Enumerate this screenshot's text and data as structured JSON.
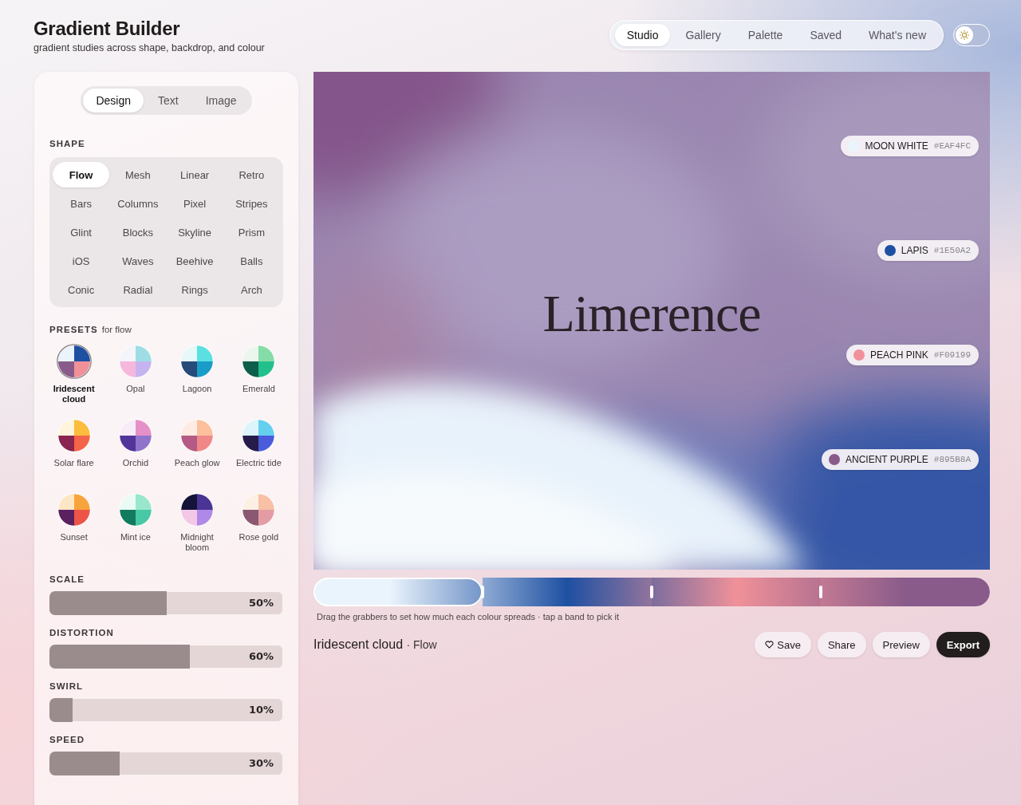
{
  "header": {
    "title": "Gradient Builder",
    "subtitle": "gradient studies across shape, backdrop, and colour"
  },
  "nav": [
    {
      "label": "Studio",
      "selected": true
    },
    {
      "label": "Gallery",
      "selected": false
    },
    {
      "label": "Palette",
      "selected": false
    },
    {
      "label": "Saved",
      "selected": false
    },
    {
      "label": "What's new",
      "selected": false
    }
  ],
  "theme_toggle": {
    "dark": false
  },
  "panel": {
    "tabs": [
      {
        "label": "Design",
        "selected": true
      },
      {
        "label": "Text",
        "selected": false
      },
      {
        "label": "Image",
        "selected": false
      }
    ],
    "shape_label": "SHAPE",
    "shapes": [
      {
        "label": "Flow",
        "selected": true
      },
      {
        "label": "Mesh",
        "selected": false
      },
      {
        "label": "Linear",
        "selected": false
      },
      {
        "label": "Retro",
        "selected": false
      },
      {
        "label": "Bars",
        "selected": false
      },
      {
        "label": "Columns",
        "selected": false
      },
      {
        "label": "Pixel",
        "selected": false
      },
      {
        "label": "Stripes",
        "selected": false
      },
      {
        "label": "Glint",
        "selected": false
      },
      {
        "label": "Blocks",
        "selected": false
      },
      {
        "label": "Skyline",
        "selected": false
      },
      {
        "label": "Prism",
        "selected": false
      },
      {
        "label": "iOS",
        "selected": false
      },
      {
        "label": "Waves",
        "selected": false
      },
      {
        "label": "Beehive",
        "selected": false
      },
      {
        "label": "Balls",
        "selected": false
      },
      {
        "label": "Conic",
        "selected": false
      },
      {
        "label": "Radial",
        "selected": false
      },
      {
        "label": "Rings",
        "selected": false
      },
      {
        "label": "Arch",
        "selected": false
      }
    ],
    "presets_label": "PRESETS",
    "presets_suffix": "for flow",
    "presets": [
      {
        "label": "Iridescent cloud",
        "selected": true,
        "quadrants": [
          {
            "color": "#eaf4fc"
          },
          {
            "color": "#1e50a2"
          },
          {
            "color": "#895b8a"
          },
          {
            "color": "#f09199"
          }
        ]
      },
      {
        "label": "Opal",
        "selected": false,
        "quadrants": [
          {
            "color": "#f4f4fb"
          },
          {
            "color": "#9fdde6"
          },
          {
            "color": "#f5b8dc"
          },
          {
            "color": "#c6b4f0"
          }
        ]
      },
      {
        "label": "Lagoon",
        "selected": false,
        "quadrants": [
          {
            "color": "#e6f8f8"
          },
          {
            "color": "#5ae0e0"
          },
          {
            "color": "#264a7a"
          },
          {
            "color": "#1a9cc8"
          }
        ]
      },
      {
        "label": "Emerald",
        "selected": false,
        "quadrants": [
          {
            "color": "#eaf6ee"
          },
          {
            "color": "#86dca6"
          },
          {
            "color": "#0e5e4c"
          },
          {
            "color": "#22c08c"
          }
        ]
      },
      {
        "label": "Solar flare",
        "selected": false,
        "quadrants": [
          {
            "color": "#fff4dc"
          },
          {
            "color": "#fcbc3c"
          },
          {
            "color": "#8a2450"
          },
          {
            "color": "#f46448"
          }
        ]
      },
      {
        "label": "Orchid",
        "selected": false,
        "quadrants": [
          {
            "color": "#f8ecf8"
          },
          {
            "color": "#e690c8"
          },
          {
            "color": "#52349a"
          },
          {
            "color": "#9074cc"
          }
        ]
      },
      {
        "label": "Peach glow",
        "selected": false,
        "quadrants": [
          {
            "color": "#fdebe4"
          },
          {
            "color": "#fcc09c"
          },
          {
            "color": "#b45a84"
          },
          {
            "color": "#f08888"
          }
        ]
      },
      {
        "label": "Electric tide",
        "selected": false,
        "quadrants": [
          {
            "color": "#dcf4fa"
          },
          {
            "color": "#64d0ee"
          },
          {
            "color": "#261c4a"
          },
          {
            "color": "#4a5cdc"
          }
        ]
      },
      {
        "label": "Sunset",
        "selected": false,
        "quadrants": [
          {
            "color": "#fde6c4"
          },
          {
            "color": "#f8a43c"
          },
          {
            "color": "#5a2060"
          },
          {
            "color": "#ec5448"
          }
        ]
      },
      {
        "label": "Mint ice",
        "selected": false,
        "quadrants": [
          {
            "color": "#eafaf4"
          },
          {
            "color": "#9ae6cc"
          },
          {
            "color": "#127a5e"
          },
          {
            "color": "#48c8a4"
          }
        ]
      },
      {
        "label": "Midnight bloom",
        "selected": false,
        "quadrants": [
          {
            "color": "#14143a"
          },
          {
            "color": "#4a3494"
          },
          {
            "color": "#f2c8e6"
          },
          {
            "color": "#b088e8"
          }
        ]
      },
      {
        "label": "Rose gold",
        "selected": false,
        "quadrants": [
          {
            "color": "#fcf0e4"
          },
          {
            "color": "#f8c0a4"
          },
          {
            "color": "#8a5870"
          },
          {
            "color": "#e49ca4"
          }
        ]
      }
    ],
    "sliders": [
      {
        "label": "SCALE",
        "level": 0.5,
        "reading": "50%"
      },
      {
        "label": "DISTORTION",
        "level": 0.6,
        "reading": "60%"
      },
      {
        "label": "SWIRL",
        "level": 0.1,
        "reading": "10%"
      },
      {
        "label": "SPEED",
        "level": 0.3,
        "reading": "30%"
      }
    ]
  },
  "preview": {
    "text": "Limerence"
  },
  "colours": [
    {
      "name": "MOON WHITE",
      "hex": "#EAF4FC",
      "color": "#eaf4fc",
      "selected": true
    },
    {
      "name": "LAPIS",
      "hex": "#1E50A2",
      "color": "#1e50a2",
      "selected": false
    },
    {
      "name": "PEACH PINK",
      "hex": "#F09199",
      "color": "#f09199",
      "selected": false
    },
    {
      "name": "ANCIENT PURPLE",
      "hex": "#895B8A",
      "color": "#895b8a",
      "selected": false
    }
  ],
  "hint": "Drag the grabbers to set how much each colour spreads · tap a band to pick it",
  "footer": {
    "name": "Iridescent cloud",
    "shape": "· Flow",
    "buttons": [
      {
        "label": "Save",
        "kind": "heart"
      },
      {
        "label": "Share",
        "kind": "plain"
      },
      {
        "label": "Preview",
        "kind": "plain"
      },
      {
        "label": "Export",
        "kind": "primary"
      }
    ]
  }
}
